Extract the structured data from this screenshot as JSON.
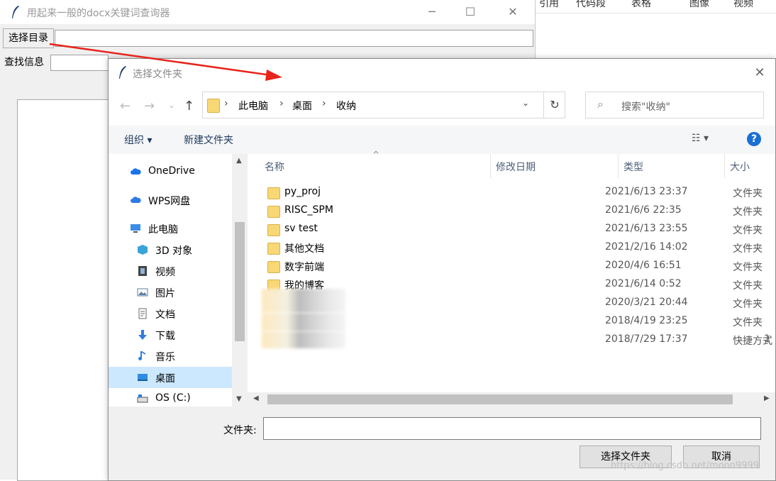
{
  "background": {
    "tabs": [
      "引用",
      "代码段",
      "表格",
      "图像",
      "视频"
    ]
  },
  "main_window": {
    "title": "用起来一般的docx关键词查询器",
    "controls": {
      "minimize": "─",
      "maximize": "☐",
      "close": "✕"
    },
    "select_dir_button": "选择目录",
    "search_label": "查找信息"
  },
  "dialog": {
    "title": "选择文件夹",
    "close": "✕",
    "nav": {
      "back": "←",
      "forward": "→",
      "recent": "⌄",
      "up": "↑"
    },
    "breadcrumb": [
      "此电脑",
      "桌面",
      "收纳"
    ],
    "breadcrumb_sep": "›",
    "address_dropdown": "⌄",
    "refresh": "↻",
    "search_placeholder": "搜索\"收纳\"",
    "search_icon": "⌕",
    "toolbar": {
      "organize": "组织 ▾",
      "new_folder": "新建文件夹",
      "view": "☷ ▾",
      "help": "?"
    },
    "nav_pane": [
      {
        "label": "OneDrive",
        "icon": "cloud-icon",
        "color": "#1a73e8"
      },
      {
        "label": "WPS网盘",
        "icon": "cloud-icon",
        "color": "#2e7be6"
      },
      {
        "label": "此电脑",
        "icon": "computer-icon",
        "color": "#3a8ee6"
      },
      {
        "label": "3D 对象",
        "icon": "cube-icon",
        "color": "#3aa3d8"
      },
      {
        "label": "视频",
        "icon": "film-icon",
        "color": "#444"
      },
      {
        "label": "图片",
        "icon": "image-icon",
        "color": "#5a7ea3"
      },
      {
        "label": "文档",
        "icon": "document-icon",
        "color": "#6a6a6a"
      },
      {
        "label": "下载",
        "icon": "download-icon",
        "color": "#2f7de1"
      },
      {
        "label": "音乐",
        "icon": "music-icon",
        "color": "#2f7de1"
      },
      {
        "label": "桌面",
        "icon": "desktop-icon",
        "color": "#2f8ddf",
        "selected": true
      },
      {
        "label": "OS (C:)",
        "icon": "drive-icon",
        "color": "#555"
      }
    ],
    "columns": {
      "name": "名称",
      "modified": "修改日期",
      "type": "类型",
      "size": "大小"
    },
    "files": [
      {
        "name": "py_proj",
        "date": "2021/6/13 23:37",
        "type": "文件夹",
        "size": ""
      },
      {
        "name": "RISC_SPM",
        "date": "2021/6/6 22:35",
        "type": "文件夹",
        "size": ""
      },
      {
        "name": "sv test",
        "date": "2021/6/13 23:55",
        "type": "文件夹",
        "size": ""
      },
      {
        "name": "其他文档",
        "date": "2021/2/16 14:02",
        "type": "文件夹",
        "size": ""
      },
      {
        "name": "数字前端",
        "date": "2020/4/6 16:51",
        "type": "文件夹",
        "size": ""
      },
      {
        "name": "我的博客",
        "date": "2021/6/14 0:52",
        "type": "文件夹",
        "size": ""
      },
      {
        "name": "",
        "date": "2020/3/21 20:44",
        "type": "文件夹",
        "size": "",
        "blurred": true
      },
      {
        "name": "",
        "date": "2018/4/19 23:25",
        "type": "文件夹",
        "size": "",
        "blurred": true
      },
      {
        "name": "",
        "date": "2018/7/29 17:37",
        "type": "快捷方式",
        "size": "1",
        "blurred": true
      }
    ],
    "folder_label": "文件夹:",
    "folder_value": "",
    "select_button": "选择文件夹",
    "cancel_button": "取消"
  },
  "watermark": "https://blog.csdn.net/moon9999"
}
